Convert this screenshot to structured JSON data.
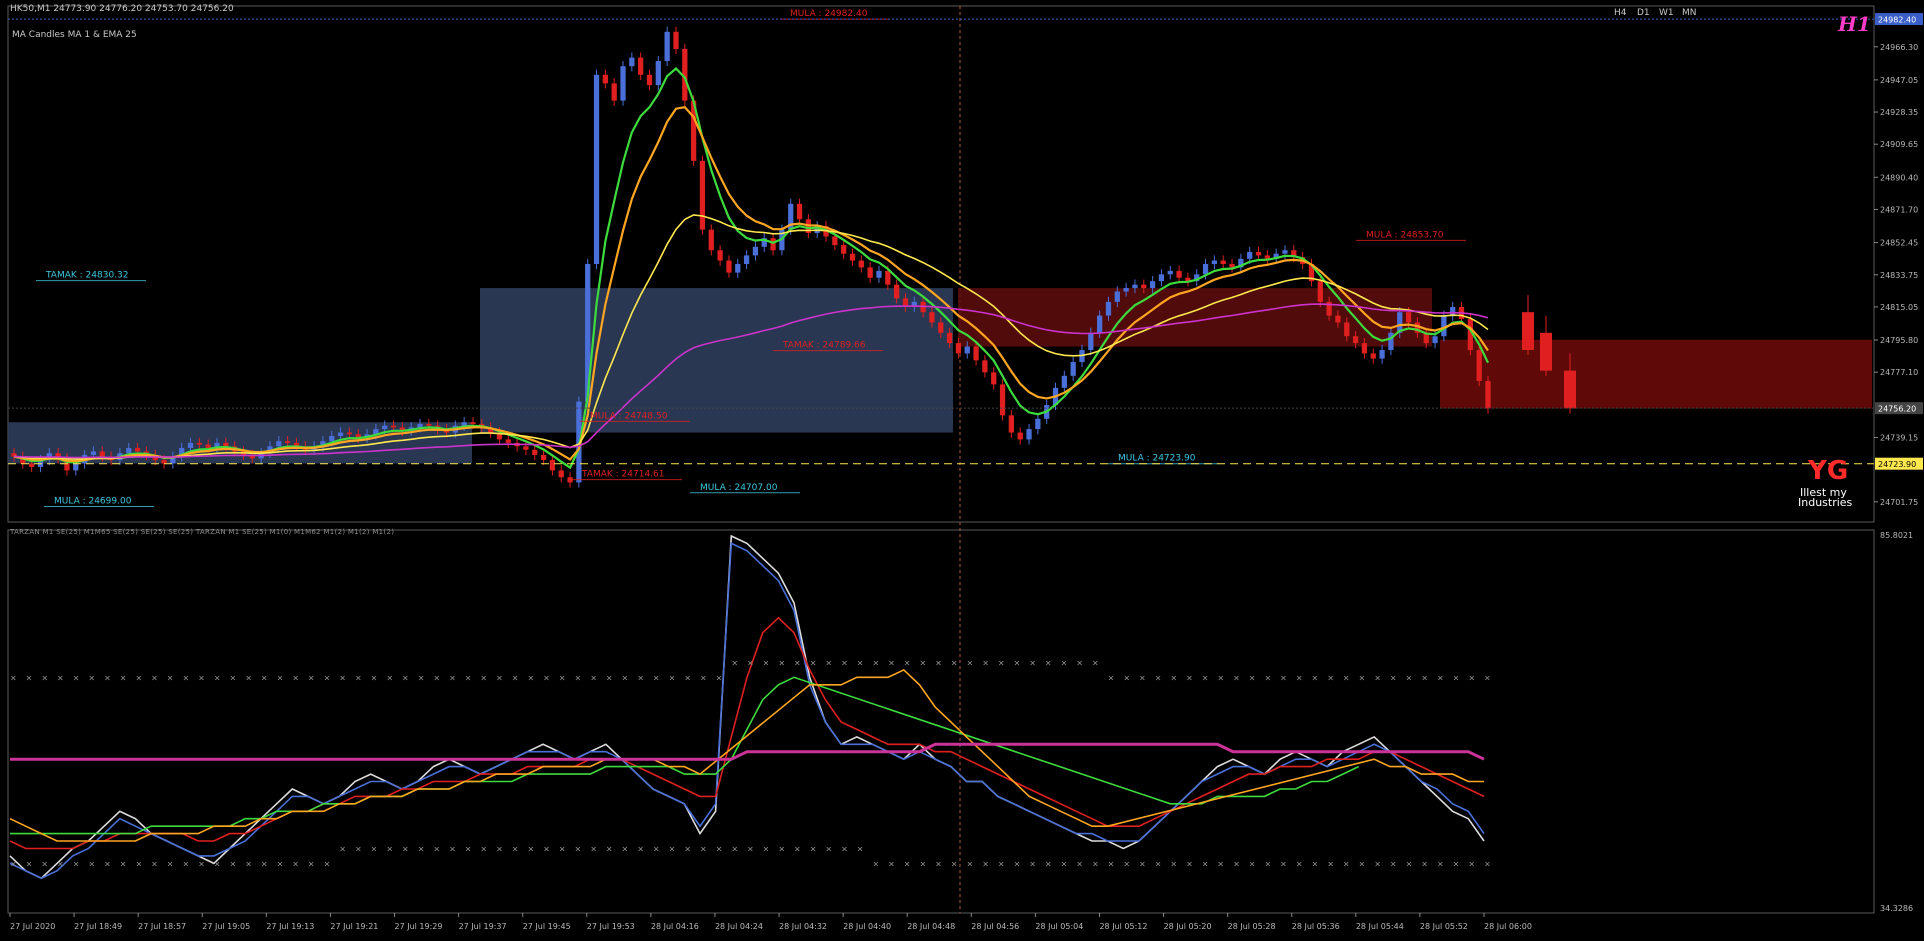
{
  "header": {
    "symbol_line": "HK50,M1  24773.90 24776.20 24753.70 24756.20",
    "indicator_line": "MA Candles  MA 1  &  EMA 25",
    "sub_indicator_line": "TARZAN M1 SE(25) M1M65 SE(25) SE(25) SE(25) TARZAN M1 SE(25) M1(0) M1M62 M1(2) M1(2) M1(2)"
  },
  "timeframes": [
    "H4",
    "D1",
    "W1",
    "MN"
  ],
  "logo_top": "H1",
  "logo_bottom": {
    "mark": "YG",
    "line1": "Illest my",
    "line2": "Industries"
  },
  "colors": {
    "bg": "#000000",
    "grid": "#3a3a3a",
    "bull": "#4a6fd8",
    "bear": "#e02020",
    "green_ma": "#3ddc3d",
    "orange_ma": "#ffa621",
    "yellow_ma": "#ffe84d",
    "magenta_ma": "#cc33cc",
    "label_red": "#e02020",
    "label_cyan": "#3ec6de"
  },
  "chart_data": [
    {
      "type": "candlestick",
      "ylim": [
        24690,
        24990
      ],
      "y_ticks": [
        "24966.30",
        "24947.05",
        "24928.35",
        "24909.65",
        "24890.40",
        "24871.70",
        "24852.45",
        "24833.75",
        "24815.05",
        "24795.80",
        "24777.10",
        "24739.15",
        "24701.75"
      ],
      "y_special": [
        {
          "value": 24982.4,
          "label": "24982.40",
          "color": "#3a5fc8"
        },
        {
          "value": 24756.2,
          "label": "24756.20",
          "color": "#444444"
        },
        {
          "value": 24723.9,
          "label": "24723.90",
          "color": "#ffe84d"
        }
      ],
      "x_ticks": [
        "27 Jul 2020",
        "27 Jul 18:49",
        "27 Jul 18:57",
        "27 Jul 19:05",
        "27 Jul 19:13",
        "27 Jul 19:21",
        "27 Jul 19:29",
        "27 Jul 19:37",
        "27 Jul 19:45",
        "27 Jul 19:53",
        "28 Jul 04:16",
        "28 Jul 04:24",
        "28 Jul 04:32",
        "28 Jul 04:40",
        "28 Jul 04:48",
        "28 Jul 04:56",
        "28 Jul 05:04",
        "28 Jul 05:12",
        "28 Jul 05:20",
        "28 Jul 05:28",
        "28 Jul 05:36",
        "28 Jul 05:44",
        "28 Jul 05:52",
        "28 Jul 06:00"
      ],
      "close": [
        24728,
        24724,
        24722,
        24726,
        24730,
        24727,
        24720,
        24724,
        24729,
        24731,
        24728,
        24726,
        24730,
        24733,
        24731,
        24729,
        24726,
        24724,
        24728,
        24733,
        24736,
        24735,
        24733,
        24736,
        24734,
        24731,
        24729,
        24727,
        24730,
        24734,
        24737,
        24736,
        24734,
        24732,
        24734,
        24737,
        24740,
        24742,
        24741,
        24739,
        24741,
        24744,
        24746,
        24745,
        24743,
        24745,
        24747,
        24746,
        24744,
        24742,
        24746,
        24748,
        24747,
        24745,
        24742,
        24738,
        24736,
        24734,
        24732,
        24729,
        24726,
        24720,
        24716,
        24713,
        24760,
        24840,
        24950,
        24945,
        24935,
        24955,
        24960,
        24950,
        24944,
        24958,
        24975,
        24965,
        24935,
        24900,
        24860,
        24848,
        24842,
        24835,
        24840,
        24845,
        24850,
        24855,
        24848,
        24860,
        24875,
        24866,
        24858,
        24862,
        24856,
        24851,
        24846,
        24842,
        24838,
        24832,
        24836,
        24828,
        24820,
        24815,
        24818,
        24812,
        24806,
        24800,
        24794,
        24788,
        24792,
        24784,
        24777,
        24770,
        24752,
        24742,
        24738,
        24744,
        24750,
        24758,
        24768,
        24775,
        24783,
        24790,
        24800,
        24810,
        24818,
        24824,
        24826,
        24828,
        24826,
        24830,
        24834,
        24836,
        24832,
        24830,
        24834,
        24840,
        24842,
        24840,
        24838,
        24843,
        24847,
        24845,
        24843,
        24846,
        24848,
        24844,
        24840,
        24830,
        24818,
        24810,
        24806,
        24798,
        24794,
        24788,
        24785,
        24790,
        24800,
        24812,
        24806,
        24800,
        24794,
        24798,
        24810,
        24815,
        24808,
        24790,
        24772,
        24756
      ],
      "series": [
        {
          "name": "",
          "color": "#3ddc3d",
          "type": "ma"
        },
        {
          "name": "",
          "color": "#ffa621",
          "type": "ma"
        },
        {
          "name": "",
          "color": "#ffe84d",
          "type": "ma"
        },
        {
          "name": "",
          "color": "#cc33cc",
          "type": "ma"
        }
      ],
      "annotations": [
        {
          "text": "MULA : 24982.40",
          "color": "#e02020",
          "y": 24982.4
        },
        {
          "text": "TAMAK : 24830.32",
          "color": "#3ec6de",
          "y": 24830.32
        },
        {
          "text": "TAMAK : 24789.66",
          "color": "#e02020",
          "y": 24789.66
        },
        {
          "text": "MULA : 24748.50",
          "color": "#e02020",
          "y": 24748.5
        },
        {
          "text": "TAMAK : 24714.61",
          "color": "#e02020",
          "y": 24714.61
        },
        {
          "text": "MULA : 24707.00",
          "color": "#3ec6de",
          "y": 24707.0
        },
        {
          "text": "MULA : 24699.00",
          "color": "#3ec6de",
          "y": 24699.0
        },
        {
          "text": "MULA : 24723.90",
          "color": "#3ec6de",
          "y": 24723.9
        },
        {
          "text": "MULA : 24853.70",
          "color": "#e02020",
          "y": 24853.7
        }
      ],
      "zones": [
        {
          "color": "#2e3d5c",
          "y_top": 24826,
          "y_bottom": 24742
        },
        {
          "color": "#2e3d5c",
          "y_top": 24748,
          "y_bottom": 24724
        },
        {
          "color": "#5a0c0c",
          "y_top": 24826,
          "y_bottom": 24792
        },
        {
          "color": "#6a0a0a",
          "y_top": 24796,
          "y_bottom": 24756
        }
      ]
    },
    {
      "type": "line",
      "ylim": [
        34.3286,
        85.8021
      ],
      "y_ticks": [
        "85.8021",
        "34.3286"
      ],
      "series": [
        {
          "name": "",
          "color": "#dddddd",
          "values": [
            42,
            40,
            39,
            41,
            43,
            44,
            46,
            48,
            47,
            45,
            44,
            43,
            42,
            41,
            43,
            45,
            47,
            49,
            51,
            50,
            49,
            50,
            52,
            53,
            52,
            51,
            52,
            54,
            55,
            54,
            53,
            54,
            55,
            56,
            57,
            56,
            55,
            56,
            57,
            55,
            53,
            51,
            50,
            49,
            45,
            48,
            85,
            84,
            82,
            80,
            76,
            66,
            60,
            57,
            58,
            57,
            56,
            55,
            57,
            55,
            54,
            52,
            52,
            50,
            49,
            48,
            47,
            46,
            45,
            44,
            44,
            43,
            44,
            46,
            48,
            50,
            52,
            54,
            55,
            54,
            53,
            55,
            56,
            55,
            54,
            56,
            57,
            58,
            56,
            54,
            52,
            50,
            48,
            47,
            44
          ]
        },
        {
          "name": "",
          "color": "#4a6fd8",
          "values": [
            41,
            40,
            39,
            40,
            42,
            43,
            45,
            47,
            46,
            45,
            44,
            43,
            42,
            42,
            43,
            44,
            46,
            48,
            50,
            50,
            49,
            50,
            51,
            52,
            52,
            51,
            52,
            53,
            54,
            54,
            53,
            54,
            55,
            56,
            56,
            56,
            55,
            56,
            56,
            55,
            53,
            51,
            50,
            49,
            46,
            49,
            84,
            83,
            81,
            79,
            75,
            65,
            60,
            57,
            57,
            57,
            56,
            55,
            56,
            55,
            54,
            52,
            52,
            50,
            49,
            48,
            47,
            46,
            45,
            45,
            44,
            44,
            44,
            46,
            48,
            50,
            52,
            53,
            54,
            54,
            53,
            54,
            55,
            55,
            54,
            55,
            56,
            57,
            56,
            54,
            52,
            51,
            49,
            48,
            45
          ]
        },
        {
          "name": "",
          "color": "#e02020",
          "values": [
            44,
            43,
            43,
            43,
            43,
            44,
            44,
            45,
            45,
            45,
            45,
            45,
            44,
            44,
            45,
            45,
            46,
            47,
            48,
            48,
            49,
            49,
            50,
            50,
            50,
            51,
            51,
            52,
            52,
            52,
            53,
            53,
            53,
            54,
            54,
            54,
            54,
            55,
            55,
            55,
            54,
            53,
            52,
            51,
            50,
            50,
            58,
            66,
            72,
            74,
            72,
            67,
            63,
            60,
            59,
            58,
            57,
            57,
            57,
            56,
            56,
            55,
            54,
            53,
            52,
            51,
            50,
            49,
            48,
            47,
            46,
            46,
            46,
            47,
            48,
            49,
            50,
            51,
            52,
            53,
            53,
            54,
            54,
            54,
            55,
            55,
            55,
            56,
            56,
            55,
            54,
            53,
            52,
            51,
            50
          ]
        },
        {
          "name": "",
          "color": "#3ddc3d",
          "values": [
            45,
            45,
            45,
            45,
            45,
            45,
            45,
            45,
            45,
            46,
            46,
            46,
            46,
            46,
            46,
            47,
            47,
            48,
            48,
            48,
            49,
            49,
            49,
            50,
            50,
            50,
            51,
            51,
            51,
            52,
            52,
            52,
            52,
            53,
            53,
            53,
            53,
            53,
            54,
            54,
            54,
            54,
            54,
            53,
            53,
            53,
            55,
            59,
            63,
            65,
            66,
            null,
            null,
            null,
            null,
            null,
            null,
            null,
            null,
            null,
            null,
            null,
            null,
            null,
            null,
            null,
            null,
            null,
            null,
            null,
            null,
            null,
            null,
            null,
            49,
            49,
            49,
            50,
            50,
            50,
            50,
            51,
            51,
            52,
            52,
            53,
            54,
            null,
            null,
            null,
            null,
            null,
            null,
            null,
            null
          ]
        },
        {
          "name": "",
          "color": "#ffa621",
          "values": [
            47,
            46,
            45,
            44,
            44,
            44,
            44,
            44,
            44,
            45,
            45,
            45,
            45,
            46,
            46,
            46,
            47,
            47,
            48,
            48,
            48,
            49,
            49,
            50,
            50,
            50,
            51,
            51,
            51,
            52,
            52,
            53,
            53,
            53,
            54,
            54,
            54,
            54,
            55,
            55,
            55,
            55,
            54,
            54,
            53,
            null,
            null,
            null,
            null,
            null,
            null,
            65,
            65,
            65,
            66,
            66,
            66,
            67,
            65,
            62,
            60,
            58,
            56,
            54,
            52,
            50,
            49,
            48,
            47,
            46,
            46,
            null,
            null,
            null,
            null,
            null,
            null,
            null,
            null,
            null,
            null,
            null,
            null,
            null,
            null,
            null,
            null,
            55,
            54,
            54,
            53,
            53,
            53,
            52,
            52
          ]
        },
        {
          "name": "",
          "color": "#cc3399",
          "values": [
            55,
            55,
            55,
            55,
            55,
            55,
            55,
            55,
            55,
            55,
            55,
            55,
            55,
            55,
            55,
            55,
            55,
            55,
            55,
            55,
            55,
            55,
            55,
            55,
            55,
            55,
            55,
            55,
            55,
            55,
            55,
            55,
            55,
            55,
            55,
            55,
            55,
            55,
            55,
            55,
            55,
            55,
            55,
            55,
            55,
            55,
            55,
            56,
            56,
            56,
            56,
            56,
            56,
            56,
            56,
            56,
            56,
            56,
            56,
            57,
            57,
            57,
            57,
            57,
            57,
            57,
            57,
            57,
            57,
            57,
            57,
            57,
            57,
            57,
            57,
            57,
            57,
            57,
            56,
            56,
            56,
            56,
            56,
            56,
            56,
            56,
            56,
            56,
            56,
            56,
            56,
            56,
            56,
            56,
            55
          ]
        }
      ]
    }
  ]
}
